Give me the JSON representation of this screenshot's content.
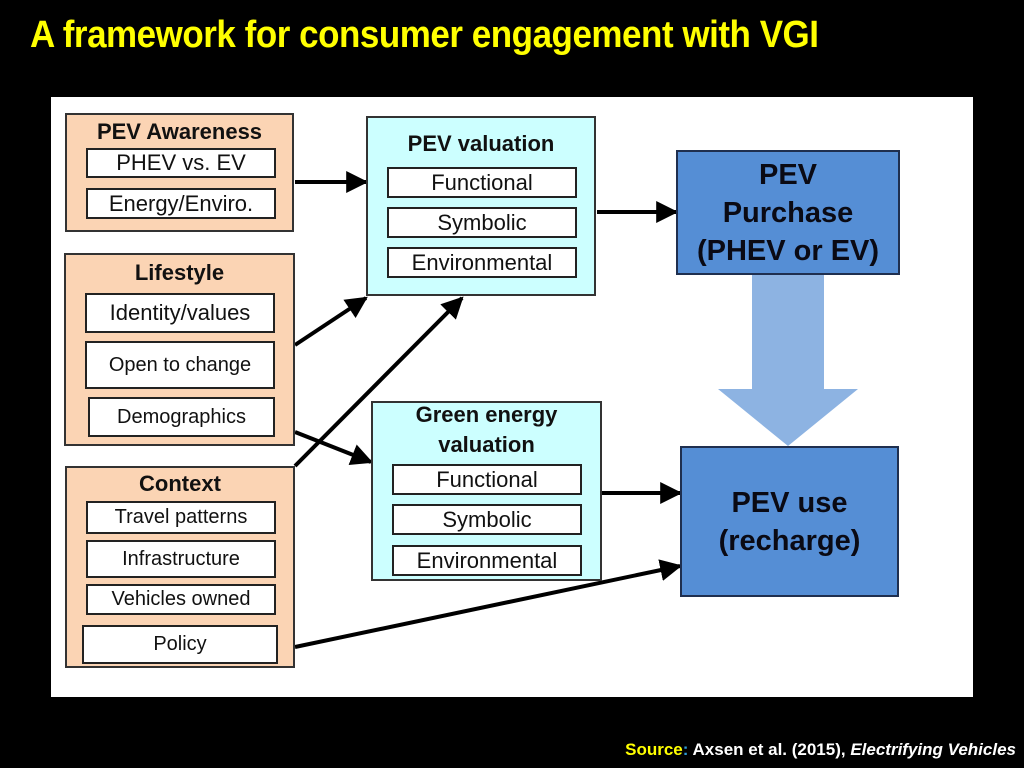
{
  "title": "A framework for consumer engagement with VGI",
  "diagram": {
    "awareness": {
      "title": "PEV Awareness",
      "items": [
        "PHEV vs. EV",
        "Energy/Enviro."
      ]
    },
    "lifestyle": {
      "title": "Lifestyle",
      "items": [
        "Identity/values",
        "Open to change",
        "Demographics"
      ]
    },
    "context": {
      "title": "Context",
      "items": [
        "Travel patterns",
        "Infrastructure",
        "Vehicles owned",
        "Policy"
      ]
    },
    "pev_valuation": {
      "title": "PEV valuation",
      "items": [
        "Functional",
        "Symbolic",
        "Environmental"
      ]
    },
    "green_valuation": {
      "title_line1": "Green energy",
      "title_line2": "valuation",
      "items": [
        "Functional",
        "Symbolic",
        "Environmental"
      ]
    },
    "purchase": {
      "line1": "PEV",
      "line2": "Purchase",
      "line3": "(PHEV or EV)"
    },
    "use": {
      "line1": "PEV use",
      "line2": "(recharge)"
    },
    "connections": [
      {
        "from": "PEV Awareness",
        "to": "PEV valuation"
      },
      {
        "from": "Lifestyle",
        "to": "PEV valuation"
      },
      {
        "from": "Lifestyle",
        "to": "Green energy valuation"
      },
      {
        "from": "Context",
        "to": "PEV valuation"
      },
      {
        "from": "Context",
        "to": "PEV use (recharge)"
      },
      {
        "from": "PEV valuation",
        "to": "PEV Purchase (PHEV or EV)"
      },
      {
        "from": "Green energy valuation",
        "to": "PEV use (recharge)"
      },
      {
        "from": "PEV Purchase (PHEV or EV)",
        "to": "PEV use (recharge)"
      }
    ],
    "colors": {
      "peach": "#fbd4b4",
      "cyan": "#ccffff",
      "blue": "#558ed5",
      "big_arrow": "#8db3e2"
    }
  },
  "source": {
    "label": "Source",
    "colon": ":",
    "authors": " Axsen et al. (2015), ",
    "work": "Electrifying Vehicles"
  }
}
